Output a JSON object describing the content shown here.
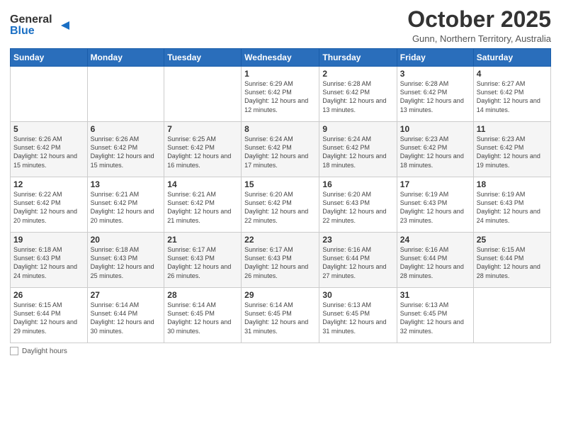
{
  "header": {
    "logo_line1": "General",
    "logo_line2": "Blue",
    "month": "October 2025",
    "location": "Gunn, Northern Territory, Australia"
  },
  "days_of_week": [
    "Sunday",
    "Monday",
    "Tuesday",
    "Wednesday",
    "Thursday",
    "Friday",
    "Saturday"
  ],
  "weeks": [
    [
      {
        "num": "",
        "info": ""
      },
      {
        "num": "",
        "info": ""
      },
      {
        "num": "",
        "info": ""
      },
      {
        "num": "1",
        "info": "Sunrise: 6:29 AM\nSunset: 6:42 PM\nDaylight: 12 hours\nand 12 minutes."
      },
      {
        "num": "2",
        "info": "Sunrise: 6:28 AM\nSunset: 6:42 PM\nDaylight: 12 hours\nand 13 minutes."
      },
      {
        "num": "3",
        "info": "Sunrise: 6:28 AM\nSunset: 6:42 PM\nDaylight: 12 hours\nand 13 minutes."
      },
      {
        "num": "4",
        "info": "Sunrise: 6:27 AM\nSunset: 6:42 PM\nDaylight: 12 hours\nand 14 minutes."
      }
    ],
    [
      {
        "num": "5",
        "info": "Sunrise: 6:26 AM\nSunset: 6:42 PM\nDaylight: 12 hours\nand 15 minutes."
      },
      {
        "num": "6",
        "info": "Sunrise: 6:26 AM\nSunset: 6:42 PM\nDaylight: 12 hours\nand 15 minutes."
      },
      {
        "num": "7",
        "info": "Sunrise: 6:25 AM\nSunset: 6:42 PM\nDaylight: 12 hours\nand 16 minutes."
      },
      {
        "num": "8",
        "info": "Sunrise: 6:24 AM\nSunset: 6:42 PM\nDaylight: 12 hours\nand 17 minutes."
      },
      {
        "num": "9",
        "info": "Sunrise: 6:24 AM\nSunset: 6:42 PM\nDaylight: 12 hours\nand 18 minutes."
      },
      {
        "num": "10",
        "info": "Sunrise: 6:23 AM\nSunset: 6:42 PM\nDaylight: 12 hours\nand 18 minutes."
      },
      {
        "num": "11",
        "info": "Sunrise: 6:23 AM\nSunset: 6:42 PM\nDaylight: 12 hours\nand 19 minutes."
      }
    ],
    [
      {
        "num": "12",
        "info": "Sunrise: 6:22 AM\nSunset: 6:42 PM\nDaylight: 12 hours\nand 20 minutes."
      },
      {
        "num": "13",
        "info": "Sunrise: 6:21 AM\nSunset: 6:42 PM\nDaylight: 12 hours\nand 20 minutes."
      },
      {
        "num": "14",
        "info": "Sunrise: 6:21 AM\nSunset: 6:42 PM\nDaylight: 12 hours\nand 21 minutes."
      },
      {
        "num": "15",
        "info": "Sunrise: 6:20 AM\nSunset: 6:42 PM\nDaylight: 12 hours\nand 22 minutes."
      },
      {
        "num": "16",
        "info": "Sunrise: 6:20 AM\nSunset: 6:43 PM\nDaylight: 12 hours\nand 22 minutes."
      },
      {
        "num": "17",
        "info": "Sunrise: 6:19 AM\nSunset: 6:43 PM\nDaylight: 12 hours\nand 23 minutes."
      },
      {
        "num": "18",
        "info": "Sunrise: 6:19 AM\nSunset: 6:43 PM\nDaylight: 12 hours\nand 24 minutes."
      }
    ],
    [
      {
        "num": "19",
        "info": "Sunrise: 6:18 AM\nSunset: 6:43 PM\nDaylight: 12 hours\nand 24 minutes."
      },
      {
        "num": "20",
        "info": "Sunrise: 6:18 AM\nSunset: 6:43 PM\nDaylight: 12 hours\nand 25 minutes."
      },
      {
        "num": "21",
        "info": "Sunrise: 6:17 AM\nSunset: 6:43 PM\nDaylight: 12 hours\nand 26 minutes."
      },
      {
        "num": "22",
        "info": "Sunrise: 6:17 AM\nSunset: 6:43 PM\nDaylight: 12 hours\nand 26 minutes."
      },
      {
        "num": "23",
        "info": "Sunrise: 6:16 AM\nSunset: 6:44 PM\nDaylight: 12 hours\nand 27 minutes."
      },
      {
        "num": "24",
        "info": "Sunrise: 6:16 AM\nSunset: 6:44 PM\nDaylight: 12 hours\nand 28 minutes."
      },
      {
        "num": "25",
        "info": "Sunrise: 6:15 AM\nSunset: 6:44 PM\nDaylight: 12 hours\nand 28 minutes."
      }
    ],
    [
      {
        "num": "26",
        "info": "Sunrise: 6:15 AM\nSunset: 6:44 PM\nDaylight: 12 hours\nand 29 minutes."
      },
      {
        "num": "27",
        "info": "Sunrise: 6:14 AM\nSunset: 6:44 PM\nDaylight: 12 hours\nand 30 minutes."
      },
      {
        "num": "28",
        "info": "Sunrise: 6:14 AM\nSunset: 6:45 PM\nDaylight: 12 hours\nand 30 minutes."
      },
      {
        "num": "29",
        "info": "Sunrise: 6:14 AM\nSunset: 6:45 PM\nDaylight: 12 hours\nand 31 minutes."
      },
      {
        "num": "30",
        "info": "Sunrise: 6:13 AM\nSunset: 6:45 PM\nDaylight: 12 hours\nand 31 minutes."
      },
      {
        "num": "31",
        "info": "Sunrise: 6:13 AM\nSunset: 6:45 PM\nDaylight: 12 hours\nand 32 minutes."
      },
      {
        "num": "",
        "info": ""
      }
    ]
  ],
  "footer": {
    "legend_label": "Daylight hours"
  }
}
